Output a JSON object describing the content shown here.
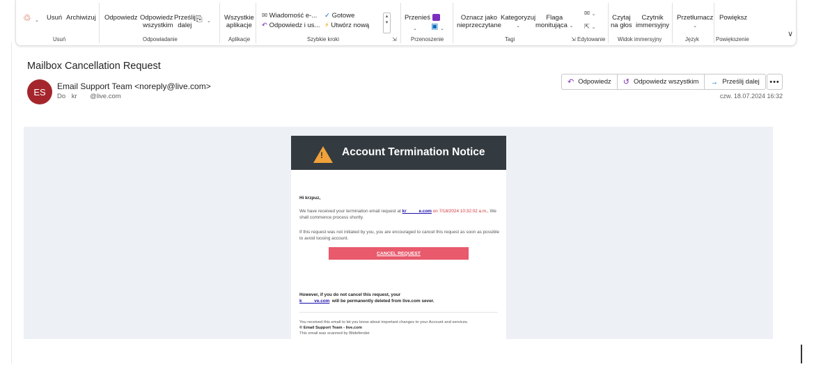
{
  "ribbon": {
    "delete_group": {
      "delete": "Usuń",
      "archive": "Archiwizuj",
      "label": "Usuń"
    },
    "respond_group": {
      "reply": "Odpowiedz",
      "reply_all_1": "Odpowiedz",
      "reply_all_2": "wszystkim",
      "forward_1": "Prześlij",
      "forward_2": "dalej",
      "label": "Odpowiadanie"
    },
    "apps_group": {
      "all_apps_1": "Wszystkie",
      "all_apps_2": "aplikacje",
      "label": "Aplikacje"
    },
    "quicksteps_group": {
      "item1": "Wiadomość e-...",
      "item2": "Gotowe",
      "item3": "Odpowiedz i us...",
      "item4": "Utwórz nową",
      "label": "Szybkie kroki"
    },
    "move_group": {
      "move": "Przenieś",
      "label": "Przenoszenie"
    },
    "tags_group": {
      "mark_unread_1": "Oznacz jako",
      "mark_unread_2": "nieprzeczytane",
      "categorize": "Kategoryzuj",
      "flag_1": "Flaga",
      "flag_2": "monitująca",
      "label": "Tagi"
    },
    "editing_group": {
      "label": "Edytowanie"
    },
    "immersive_group": {
      "read_aloud_1": "Czytaj",
      "read_aloud_2": "na głos",
      "immersive_1": "Czytnik",
      "immersive_2": "immersyjny",
      "label": "Widok immersyjny"
    },
    "language_group": {
      "translate": "Przetłumacz",
      "label": "Język"
    },
    "zoom_group": {
      "zoom": "Powiększ",
      "label": "Powiększenie"
    }
  },
  "message": {
    "subject": "Mailbox Cancellation Request",
    "avatar_initials": "ES",
    "sender": "Email Support Team <noreply@live.com>",
    "to_label": "Do",
    "to_value": "kr       @live.com",
    "date": "czw. 18.07.2024 16:32",
    "actions": {
      "reply": "Odpowiedz",
      "reply_all": "Odpowiedz wszystkim",
      "forward": "Prześlij dalej",
      "more": "•••"
    }
  },
  "email_body": {
    "banner_title": "Account Termination Notice",
    "greeting": "Hi krzpuz,",
    "p1_a": "We have received your termination email request at ",
    "p1_link": "kr          e.com",
    "p1_date": " on 7/18/2024 10:32:02 a.m.",
    "p1_b": ", We shall commence process shortly.",
    "p2": "If this request was not initiated by you, you are encouraged to cancel this request as soon as possible to avoid loosing account.",
    "cancel_button": "CANCEL REQUEST",
    "warning_a": "However, if you do not cancel this request, your ",
    "warning_link": "k          ve.com",
    "warning_b": "  will be permanently deleted from live.com sever.",
    "footer_1": "You received this email to let you know about important changes to your Account and services.",
    "footer_2": "© Email Support Team - live.com",
    "footer_3": "This email was scanned by Bitdefender"
  },
  "icons": [
    "delete-icon",
    "reply-icon",
    "reply-all-icon",
    "forward-icon",
    "warning-icon",
    "more-icon",
    "chevron-down-icon"
  ],
  "colors": {
    "avatar": "#a4262c",
    "banner": "#333a40",
    "cancel_button": "#e85a6c",
    "warning": "#f0a13a",
    "link": "#1a0dab",
    "date_red": "#d13438"
  }
}
